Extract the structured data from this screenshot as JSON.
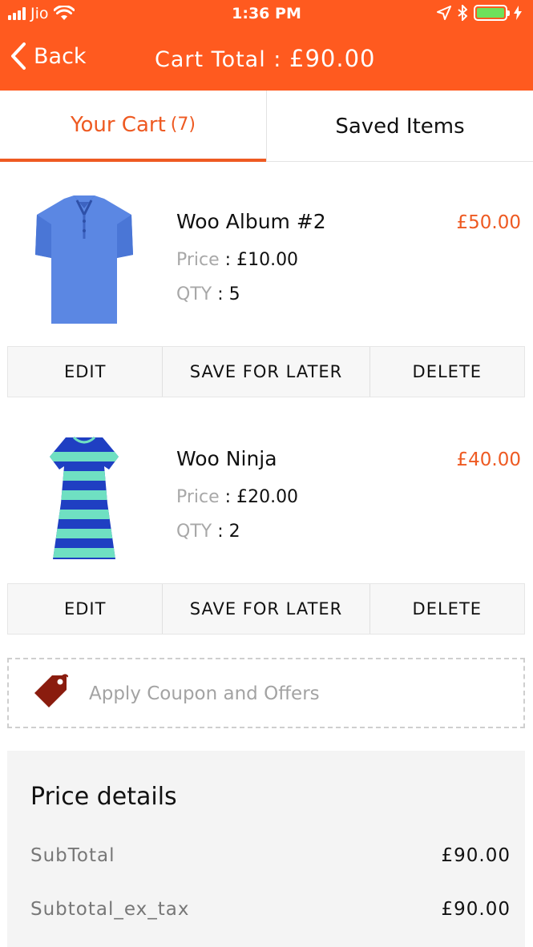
{
  "status_bar": {
    "carrier": "Jio",
    "time": "1:36 PM",
    "battery_color": "#6ee15b",
    "icons": [
      "signal-icon",
      "wifi-icon",
      "location-arrow-icon",
      "bluetooth-icon",
      "battery-icon",
      "charging-icon"
    ]
  },
  "header": {
    "back_label": "Back",
    "title_prefix": "Cart Total : ",
    "title_amount": "£90.00",
    "accent_color": "#ff5a1f"
  },
  "tabs": [
    {
      "label": "Your Cart",
      "count": "(7)",
      "active": true
    },
    {
      "label": "Saved Items",
      "active": false
    }
  ],
  "cart_items": [
    {
      "name": "Woo Album #2",
      "price_label": "Price",
      "price_value": "£10.00",
      "qty_label": "QTY",
      "qty_value": "5",
      "line_total": "£50.00",
      "image": "blue-polo-shirt",
      "actions": [
        "EDIT",
        "SAVE FOR LATER",
        "DELETE"
      ]
    },
    {
      "name": "Woo Ninja",
      "price_label": "Price",
      "price_value": "£20.00",
      "qty_label": "QTY",
      "qty_value": "2",
      "line_total": "£40.00",
      "image": "striped-dress",
      "actions": [
        "EDIT",
        "SAVE FOR LATER",
        "DELETE"
      ]
    }
  ],
  "coupon": {
    "label": "Apply Coupon and Offers",
    "icon": "price-tag-icon"
  },
  "price_details": {
    "title": "Price details",
    "rows": [
      {
        "label": "SubTotal",
        "value": "£90.00"
      },
      {
        "label": "Subtotal_ex_tax",
        "value": "£90.00"
      }
    ]
  }
}
